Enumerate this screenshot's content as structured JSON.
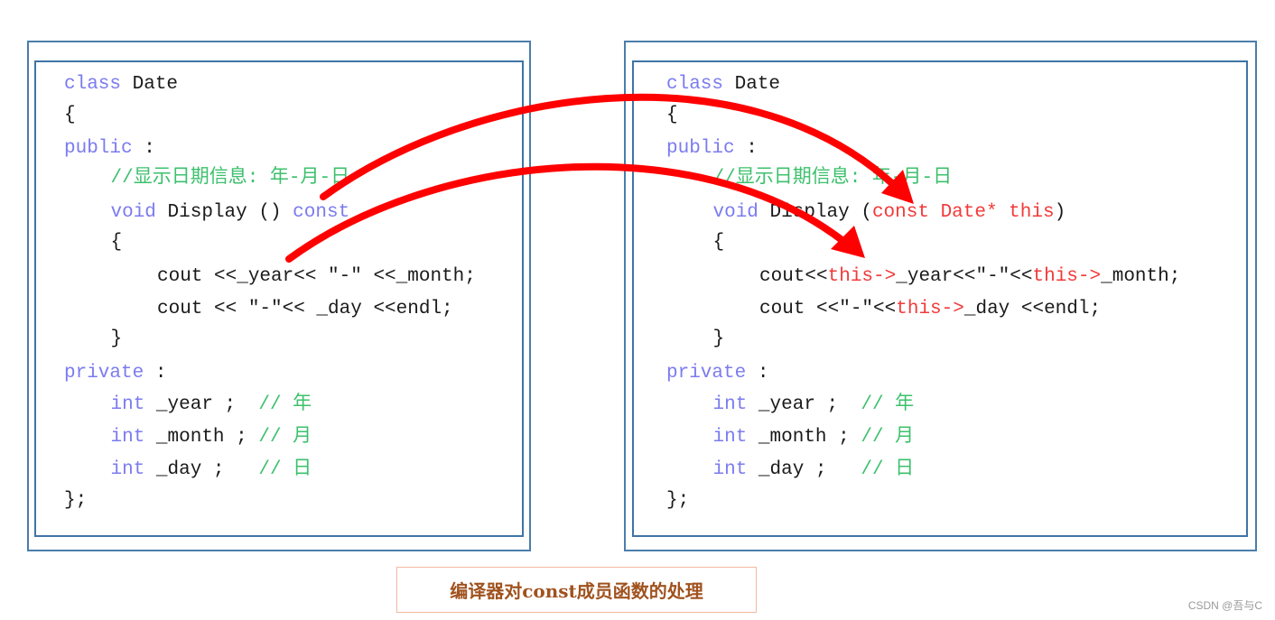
{
  "colors": {
    "keyword": "#7b7bf0",
    "comment": "#3cc06c",
    "highlight": "#f23a3a",
    "text": "#1a1a1a",
    "arrow": "#ff0000",
    "frame": "#4a7eab",
    "caption": "#a0521f"
  },
  "left_code": [
    {
      "indent": 0,
      "segs": [
        {
          "t": "class",
          "c": "kw"
        },
        {
          "t": " Date",
          "c": "pl"
        }
      ]
    },
    {
      "indent": 0,
      "segs": [
        {
          "t": "{",
          "c": "pl"
        }
      ]
    },
    {
      "indent": 0,
      "segs": [
        {
          "t": "public",
          "c": "kw"
        },
        {
          "t": " :",
          "c": "pl"
        }
      ]
    },
    {
      "indent": 1,
      "segs": [
        {
          "t": "//显示日期信息: 年-月-日",
          "c": "cm"
        }
      ]
    },
    {
      "indent": 1,
      "segs": [
        {
          "t": "void",
          "c": "kw"
        },
        {
          "t": " Display () ",
          "c": "pl"
        },
        {
          "t": "const",
          "c": "kw"
        }
      ]
    },
    {
      "indent": 1,
      "segs": [
        {
          "t": "{",
          "c": "pl"
        }
      ]
    },
    {
      "indent": 2,
      "segs": [
        {
          "t": "cout <<_year<< \"-\" <<_month;",
          "c": "pl"
        }
      ]
    },
    {
      "indent": 2,
      "segs": [
        {
          "t": "cout << \"-\"<< _day <<endl;",
          "c": "pl"
        }
      ]
    },
    {
      "indent": 1,
      "segs": [
        {
          "t": "}",
          "c": "pl"
        }
      ]
    },
    {
      "indent": 0,
      "segs": [
        {
          "t": "private",
          "c": "kw"
        },
        {
          "t": " :",
          "c": "pl"
        }
      ]
    },
    {
      "indent": 1,
      "segs": [
        {
          "t": "int",
          "c": "kw"
        },
        {
          "t": " _year ;  ",
          "c": "pl"
        },
        {
          "t": "// 年",
          "c": "cm"
        }
      ]
    },
    {
      "indent": 1,
      "segs": [
        {
          "t": "int",
          "c": "kw"
        },
        {
          "t": " _month ; ",
          "c": "pl"
        },
        {
          "t": "// 月",
          "c": "cm"
        }
      ]
    },
    {
      "indent": 1,
      "segs": [
        {
          "t": "int",
          "c": "kw"
        },
        {
          "t": " _day ;   ",
          "c": "pl"
        },
        {
          "t": "// 日",
          "c": "cm"
        }
      ]
    },
    {
      "indent": 0,
      "segs": [
        {
          "t": "};",
          "c": "pl"
        }
      ]
    }
  ],
  "right_code": [
    {
      "indent": 0,
      "segs": [
        {
          "t": "class",
          "c": "kw"
        },
        {
          "t": " Date",
          "c": "pl"
        }
      ]
    },
    {
      "indent": 0,
      "segs": [
        {
          "t": "{",
          "c": "pl"
        }
      ]
    },
    {
      "indent": 0,
      "segs": [
        {
          "t": "public",
          "c": "kw"
        },
        {
          "t": " :",
          "c": "pl"
        }
      ]
    },
    {
      "indent": 1,
      "segs": [
        {
          "t": "//显示日期信息: 年-月-日",
          "c": "cm"
        }
      ]
    },
    {
      "indent": 1,
      "segs": [
        {
          "t": "void",
          "c": "kw"
        },
        {
          "t": " Display (",
          "c": "pl"
        },
        {
          "t": "const Date* this",
          "c": "rd"
        },
        {
          "t": ")",
          "c": "pl"
        }
      ]
    },
    {
      "indent": 1,
      "segs": [
        {
          "t": "{",
          "c": "pl"
        }
      ]
    },
    {
      "indent": 2,
      "segs": [
        {
          "t": "cout<<",
          "c": "pl"
        },
        {
          "t": "this->",
          "c": "rd"
        },
        {
          "t": "_year<<\"-\"<<",
          "c": "pl"
        },
        {
          "t": "this->",
          "c": "rd"
        },
        {
          "t": "_month;",
          "c": "pl"
        }
      ]
    },
    {
      "indent": 2,
      "segs": [
        {
          "t": "cout <<\"-\"<<",
          "c": "pl"
        },
        {
          "t": "this->",
          "c": "rd"
        },
        {
          "t": "_day <<endl;",
          "c": "pl"
        }
      ]
    },
    {
      "indent": 1,
      "segs": [
        {
          "t": "}",
          "c": "pl"
        }
      ]
    },
    {
      "indent": 0,
      "segs": [
        {
          "t": "private",
          "c": "kw"
        },
        {
          "t": " :",
          "c": "pl"
        }
      ]
    },
    {
      "indent": 1,
      "segs": [
        {
          "t": "int",
          "c": "kw"
        },
        {
          "t": " _year ;  ",
          "c": "pl"
        },
        {
          "t": "// 年",
          "c": "cm"
        }
      ]
    },
    {
      "indent": 1,
      "segs": [
        {
          "t": "int",
          "c": "kw"
        },
        {
          "t": " _month ; ",
          "c": "pl"
        },
        {
          "t": "// 月",
          "c": "cm"
        }
      ]
    },
    {
      "indent": 1,
      "segs": [
        {
          "t": "int",
          "c": "kw"
        },
        {
          "t": " _day ;   ",
          "c": "pl"
        },
        {
          "t": "// 日",
          "c": "cm"
        }
      ]
    },
    {
      "indent": 0,
      "segs": [
        {
          "t": "};",
          "c": "pl"
        }
      ]
    }
  ],
  "arrows": [
    {
      "from": "const qualifier",
      "to": "const Date* this parameter"
    },
    {
      "from": "_year member access",
      "to": "this-> member access"
    }
  ],
  "caption": "编译器对const成员函数的处理",
  "watermark": "CSDN @吾与C"
}
